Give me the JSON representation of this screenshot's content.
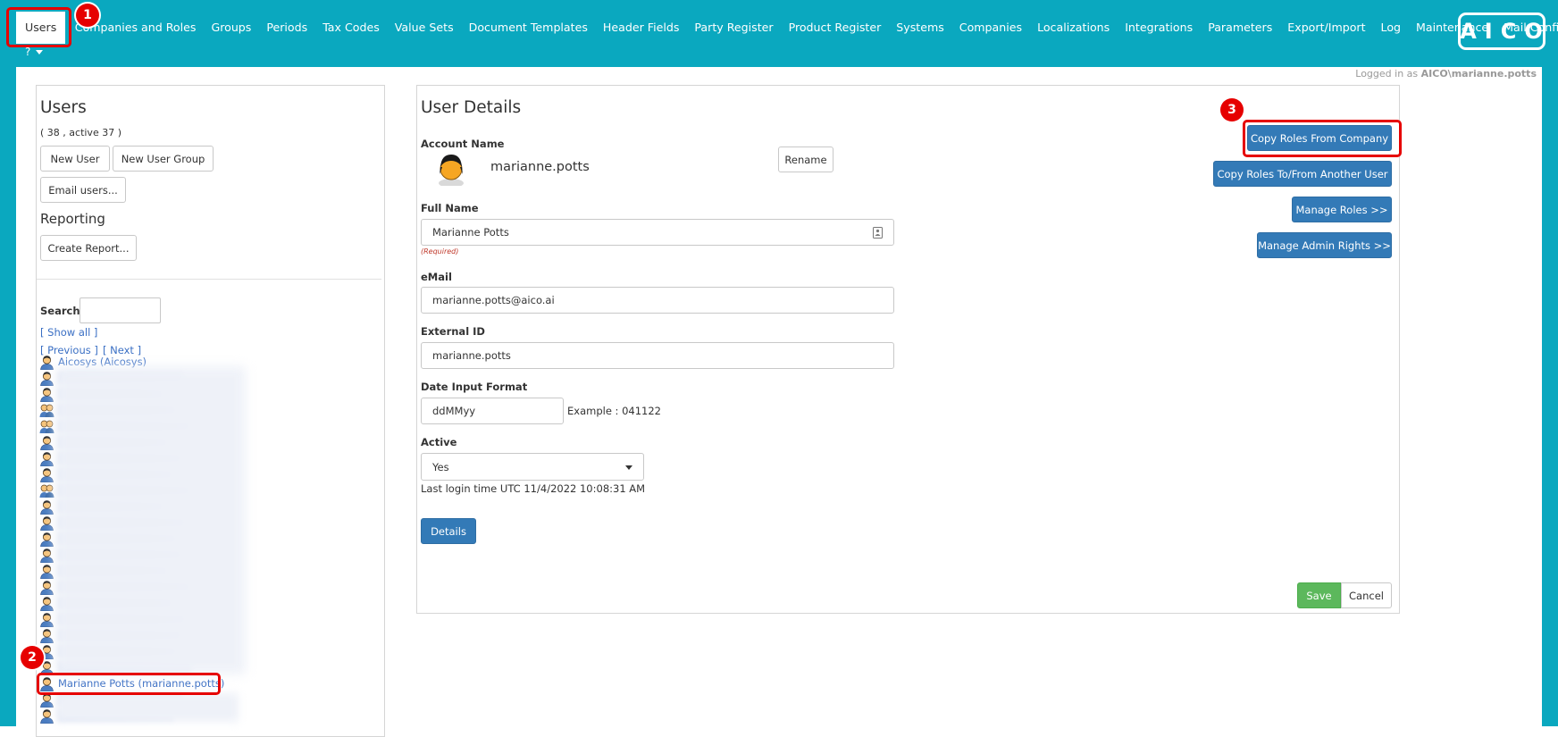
{
  "nav": {
    "items": [
      "Users",
      "Companies and Roles",
      "Groups",
      "Periods",
      "Tax Codes",
      "Value Sets",
      "Document Templates",
      "Header Fields",
      "Party Register",
      "Product Register",
      "Systems",
      "Companies",
      "Localizations",
      "Integrations",
      "Parameters",
      "Export/Import",
      "Log",
      "Maintenance",
      "Mail Configuration"
    ],
    "active": "Users",
    "help_label": "?",
    "logo_text": "AICO"
  },
  "session": {
    "prefix": "Logged in as",
    "user": "AICO\\marianne.potts"
  },
  "users_panel": {
    "title": "Users",
    "count": "( 38 , active 37 )",
    "new_user_label": "New User",
    "new_user_group_label": "New User Group",
    "email_users_label": "Email users...",
    "reporting_title": "Reporting",
    "create_report_label": "Create Report...",
    "search_label": "Search:",
    "search_value": "",
    "show_all_label": "[ Show all ]",
    "previous_label": "[ Previous ]",
    "next_label": "[ Next ]",
    "first_user": "Aicosys (Aicosys)",
    "selected_user": "Marianne Potts (marianne.potts)"
  },
  "user_details": {
    "title": "User Details",
    "account_name_label": "Account Name",
    "account_name": "marianne.potts",
    "rename_label": "Rename",
    "full_name_label": "Full Name",
    "full_name": "Marianne Potts",
    "required_text": "(Required)",
    "email_label": "eMail",
    "email": "marianne.potts@aico.ai",
    "external_id_label": "External ID",
    "external_id": "marianne.potts",
    "date_format_label": "Date Input Format",
    "date_format": "ddMMyy",
    "date_example": "Example : 041122",
    "active_label": "Active",
    "active_value": "Yes",
    "last_login": "Last login time UTC 11/4/2022 10:08:31 AM",
    "details_label": "Details",
    "copy_roles_company_label": "Copy Roles From Company",
    "copy_roles_user_label": "Copy Roles To/From Another User",
    "manage_roles_label": "Manage Roles >>",
    "manage_admin_label": "Manage Admin Rights >>",
    "save_label": "Save",
    "cancel_label": "Cancel"
  },
  "callouts": [
    "1",
    "2",
    "3"
  ],
  "colors": {
    "nav_bg": "#0aa8bf",
    "primary": "#337ab7",
    "success": "#5cb85c",
    "callout": "#e60000",
    "link": "#3a6fc4"
  }
}
